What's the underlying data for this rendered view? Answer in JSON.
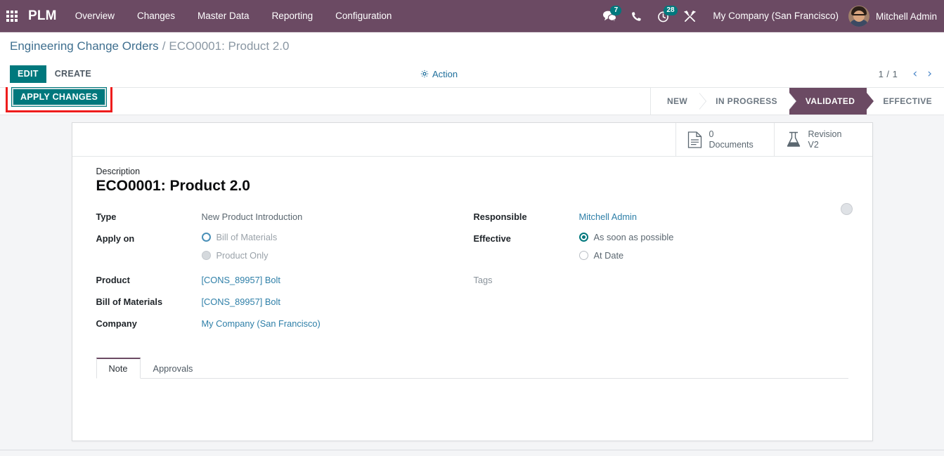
{
  "navbar": {
    "apps_icon": "apps-grid-icon",
    "brand": "PLM",
    "menus": [
      {
        "label": "Overview"
      },
      {
        "label": "Changes"
      },
      {
        "label": "Master Data"
      },
      {
        "label": "Reporting"
      },
      {
        "label": "Configuration"
      }
    ],
    "icons": [
      {
        "name": "messages-icon",
        "badge": "7"
      },
      {
        "name": "phone-icon",
        "badge": ""
      },
      {
        "name": "activities-clock-icon",
        "badge": "28"
      },
      {
        "name": "debug-tools-icon",
        "badge": ""
      }
    ],
    "company": "My Company (San Francisco)",
    "user": "Mitchell Admin",
    "background_color": "#6b4a63",
    "badge_color": "#00787d"
  },
  "breadcrumb": {
    "parent": "Engineering Change Orders",
    "separator": "/",
    "current": "ECO0001: Product 2.0"
  },
  "control_panel": {
    "edit_label": "EDIT",
    "create_label": "CREATE",
    "action_label": "Action",
    "action_icon": "gear-icon",
    "pager_count": "1 / 1",
    "pager_prev": "‹",
    "pager_next": "›"
  },
  "statusbar": {
    "apply_changes_label": "APPLY CHANGES",
    "highlight_color": "#ee1c1c",
    "stages": [
      {
        "label": "NEW",
        "active": false
      },
      {
        "label": "IN PROGRESS",
        "active": false
      },
      {
        "label": "VALIDATED",
        "active": true
      },
      {
        "label": "EFFECTIVE",
        "active": false
      }
    ]
  },
  "sheet": {
    "stat_buttons": [
      {
        "icon": "document-icon",
        "value": "0",
        "label": "Documents"
      },
      {
        "icon": "flask-icon",
        "value": "Revision",
        "label": "V2"
      }
    ],
    "kanban_state_icon": "kanban-state-dot",
    "description_label": "Description",
    "description_value": "ECO0001: Product 2.0",
    "left_fields": {
      "type_label": "Type",
      "type_value": "New Product Introduction",
      "apply_on_label": "Apply on",
      "apply_on_options": [
        {
          "label": "Bill of Materials",
          "state": "ring"
        },
        {
          "label": "Product Only",
          "state": "filled-grey"
        }
      ],
      "product_label": "Product",
      "product_value": "[CONS_89957] Bolt",
      "bom_label": "Bill of Materials",
      "bom_value": "[CONS_89957] Bolt",
      "company_label": "Company",
      "company_value": "My Company (San Francisco)"
    },
    "right_fields": {
      "responsible_label": "Responsible",
      "responsible_value": "Mitchell Admin",
      "effective_label": "Effective",
      "effective_options": [
        {
          "label": "As soon as possible",
          "state": "checked"
        },
        {
          "label": "At Date",
          "state": "empty"
        }
      ],
      "tags_label": "Tags"
    },
    "tabs": [
      {
        "label": "Note",
        "active": true
      },
      {
        "label": "Approvals",
        "active": false
      }
    ]
  }
}
